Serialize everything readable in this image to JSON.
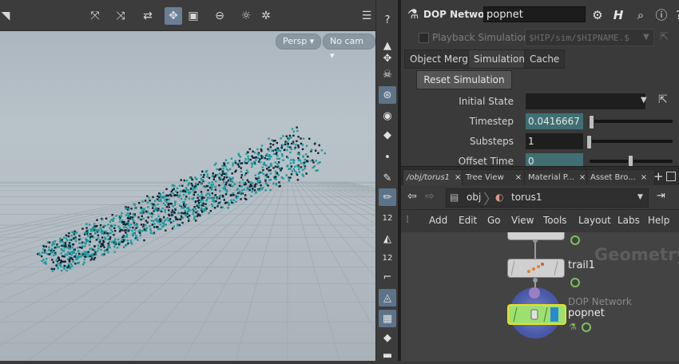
{
  "viewport": {
    "toolbar_icons": [
      "select-transform-icon",
      "select-geo-icon",
      "handle-tool-icon",
      "camera-view-icon",
      "display-options-icon",
      "no-render-icon",
      "snapshot-icon",
      "settings-icon",
      "display-list-icon",
      "help-icon"
    ],
    "camera_button": "Persp ▾",
    "cam_button": "No cam ▾"
  },
  "shelf": {
    "labels": [
      "12",
      "12"
    ]
  },
  "params": {
    "op_type": "DOP Network",
    "op_name": "popnet",
    "playback_label": "Playback Simulation",
    "playback_path": "$HIP/sim/$HIPNAME.$",
    "tabs": [
      "Object Merge",
      "Simulation",
      "Cache"
    ],
    "reset_button": "Reset Simulation",
    "initial_state_label": "Initial State",
    "timestep_label": "Timestep",
    "timestep_value": "0.0416667",
    "substeps_label": "Substeps",
    "substeps_value": "1",
    "offset_label": "Offset Time",
    "offset_value": "0"
  },
  "network": {
    "tabs": [
      {
        "label": "/obj/torus1",
        "close": "×"
      },
      {
        "label": "Tree View",
        "close": "×"
      },
      {
        "label": "Material P...",
        "close": "×"
      },
      {
        "label": "Asset Bro...",
        "close": "×"
      }
    ],
    "add_tab": "+",
    "path_root": "obj",
    "path_current": "torus1",
    "menus": [
      "Add",
      "Edit",
      "Go",
      "View",
      "Tools",
      "Layout",
      "Labs",
      "Help"
    ],
    "watermark": "Geometry",
    "nodes": {
      "trail_name": "trail1",
      "dop_type": "DOP Network",
      "dop_name": "popnet"
    }
  },
  "colors": {
    "particles": "#1a9a9c",
    "teal_field": "#3f6f73",
    "selected_node": "#e8e020"
  }
}
